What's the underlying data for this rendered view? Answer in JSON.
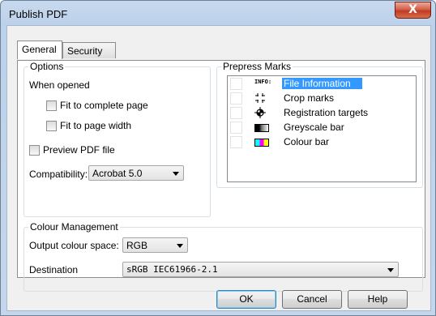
{
  "window": {
    "title": "Publish PDF",
    "close_label": "X"
  },
  "tabs": [
    {
      "label": "General"
    },
    {
      "label": "Security"
    }
  ],
  "options": {
    "group_label": "Options",
    "when_opened_label": "When opened",
    "fit_complete_label": "Fit to complete page",
    "fit_width_label": "Fit to page width",
    "preview_label": "Preview PDF file",
    "compat_label": "Compatibility:",
    "compat_value": "Acrobat 5.0"
  },
  "prepress": {
    "group_label": "Prepress Marks",
    "items": [
      {
        "label": "File Information",
        "icon": "info-icon",
        "icon_text": "INFO:",
        "selected": true
      },
      {
        "label": "Crop marks",
        "icon": "crop-marks-icon"
      },
      {
        "label": "Registration targets",
        "icon": "registration-target-icon"
      },
      {
        "label": "Greyscale bar",
        "icon": "greyscale-bar-icon"
      },
      {
        "label": "Colour bar",
        "icon": "colour-bar-icon"
      }
    ]
  },
  "colour_management": {
    "group_label": "Colour Management",
    "output_label": "Output colour space:",
    "output_value": "RGB",
    "destination_label": "Destination",
    "destination_value": "sRGB IEC61966-2.1"
  },
  "buttons": {
    "ok": "OK",
    "cancel": "Cancel",
    "help": "Help"
  },
  "colors": {
    "selection": "#3399ff",
    "close_button": "#c9462c",
    "titlebar": "#c4d6ec"
  }
}
